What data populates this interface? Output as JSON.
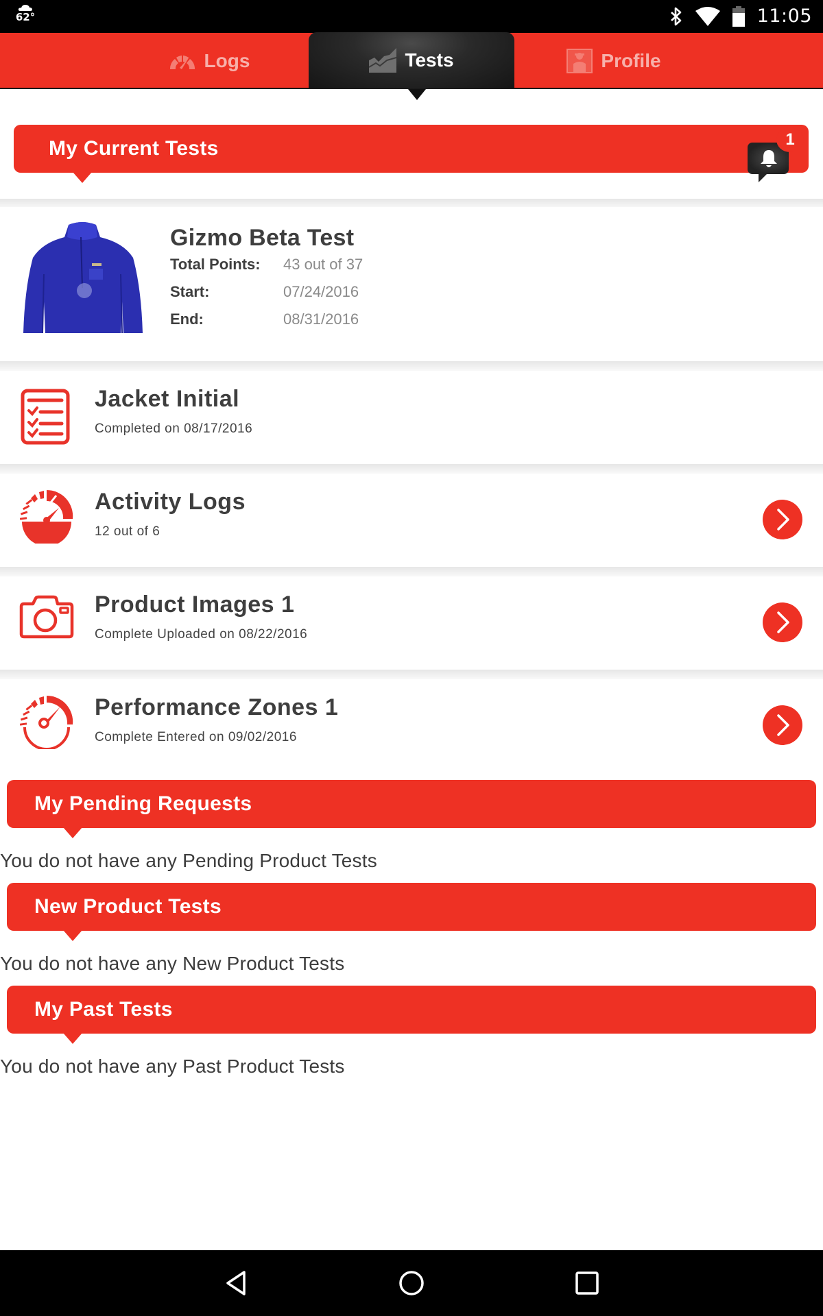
{
  "status_bar": {
    "weather_icon": "cloud-icon",
    "temperature": "62°",
    "icons": [
      "bluetooth-icon",
      "wifi-icon",
      "battery-icon"
    ],
    "time": "11:05"
  },
  "tabs": [
    {
      "label": "Logs",
      "icon": "speedometer-icon",
      "active": false
    },
    {
      "label": "Tests",
      "icon": "area-chart-icon",
      "active": true
    },
    {
      "label": "Profile",
      "icon": "profile-photo-icon",
      "active": false
    }
  ],
  "current_tests": {
    "header": "My Current Tests",
    "notification_count": "1",
    "summary": {
      "title": "Gizmo Beta Test",
      "image": "blue fleece jacket",
      "total_points_label": "Total Points:",
      "total_points_value": "43 out of 37",
      "start_label": "Start:",
      "start_value": "07/24/2016",
      "end_label": "End:",
      "end_value": "08/31/2016"
    },
    "tasks": [
      {
        "title": "Jacket Initial",
        "subtitle": "Completed on 08/17/2016",
        "icon": "checklist-icon",
        "has_arrow": false
      },
      {
        "title": "Activity Logs",
        "subtitle": "12 out of 6",
        "icon": "speedometer-filled-icon",
        "has_arrow": true
      },
      {
        "title": "Product Images 1",
        "subtitle": "Complete Uploaded on 08/22/2016",
        "icon": "camera-icon",
        "has_arrow": true
      },
      {
        "title": "Performance Zones 1",
        "subtitle": "Complete Entered on 09/02/2016",
        "icon": "gauge-icon",
        "has_arrow": true
      }
    ]
  },
  "pending_requests": {
    "header": "My Pending Requests",
    "empty_message": "You do not have any Pending Product Tests"
  },
  "new_product_tests": {
    "header": "New Product Tests",
    "empty_message": "You do not have any New Product Tests"
  },
  "past_tests": {
    "header": "My Past Tests",
    "empty_message": "You do not have any Past Product Tests"
  },
  "colors": {
    "brand_red": "#ee3124",
    "active_tab": "#1a1a1a",
    "text_dark": "#3e3e3e",
    "text_muted": "#8a8a8a"
  }
}
